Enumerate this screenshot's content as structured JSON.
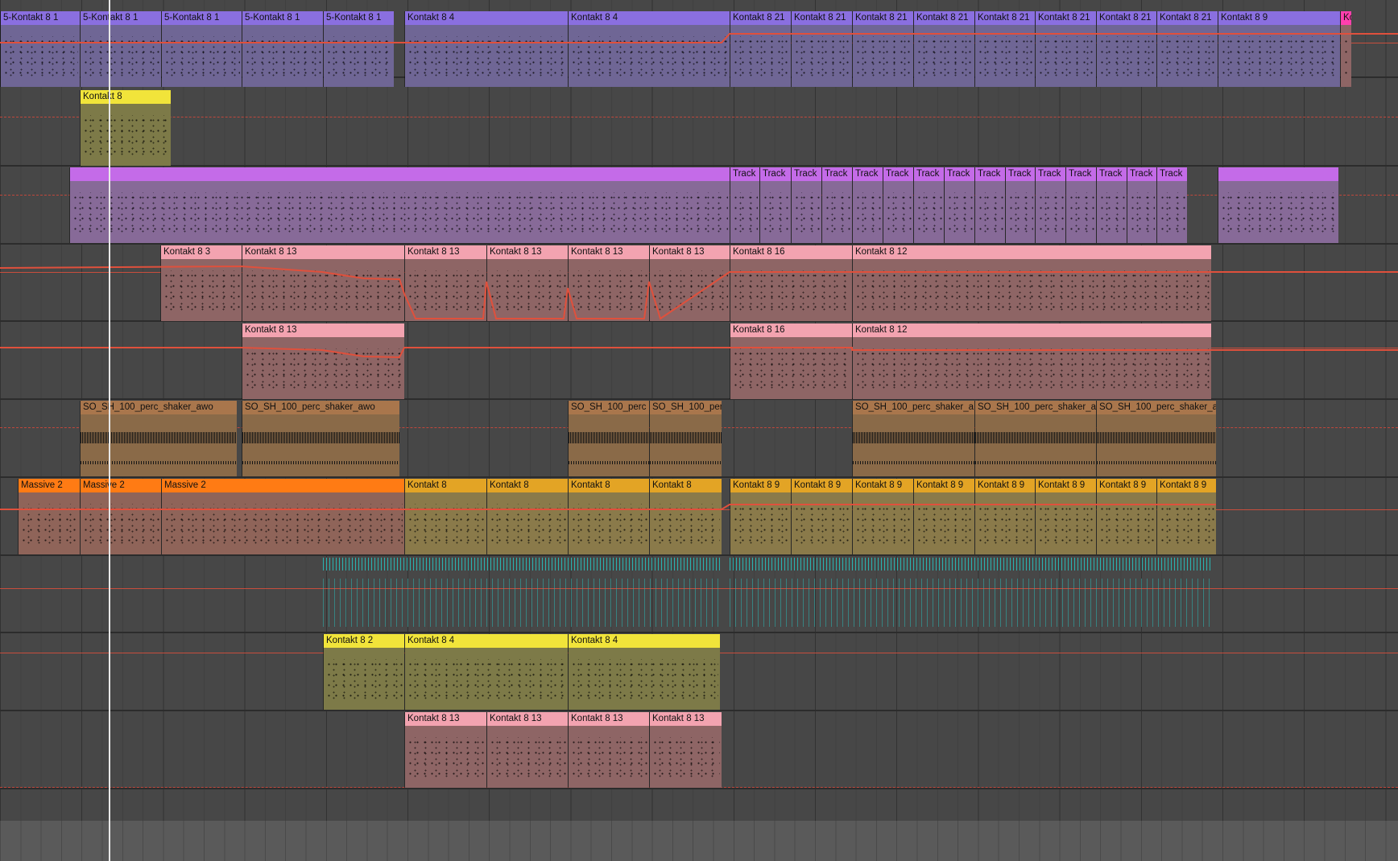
{
  "colors": {
    "violet_head": "#8a6fe0",
    "violet_body": "#6f6695",
    "yellow_head": "#f1e43a",
    "olive_body": "#7d7a48",
    "purple_head": "#c46be8",
    "purple_body": "#876a98",
    "pink_head": "#f3a3b0",
    "pink_body": "#8e6565",
    "brown_head": "#a9764c",
    "brown_body": "#8a6a48",
    "orange_head": "#ff7b14",
    "orange_body": "#8f6459",
    "gold_head": "#e3a425",
    "gold_body": "#8a7a4a",
    "magenta_head": "#ff3fae",
    "automation": "#e0503c",
    "playhead": "#e8e8e8"
  },
  "tracks": [
    {
      "name": "track-1",
      "clips": [
        {
          "label": "5-Kontakt 8 1",
          "color": "violet"
        },
        {
          "label": "5-Kontakt 8 1",
          "color": "violet"
        },
        {
          "label": "5-Kontakt 8 1",
          "color": "violet"
        },
        {
          "label": "5-Kontakt 8 1",
          "color": "violet"
        },
        {
          "label": "5-Kontakt 8 1",
          "color": "violet"
        },
        {
          "label": "Kontakt 8 4",
          "color": "violet"
        },
        {
          "label": "Kontakt 8 4",
          "color": "violet"
        },
        {
          "label": "Kontakt 8 21",
          "color": "violet"
        },
        {
          "label": "Kontakt 8 21",
          "color": "violet"
        },
        {
          "label": "Kontakt 8 21",
          "color": "violet"
        },
        {
          "label": "Kontakt 8 21",
          "color": "violet"
        },
        {
          "label": "Kontakt 8 21",
          "color": "violet"
        },
        {
          "label": "Kontakt 8 21",
          "color": "violet"
        },
        {
          "label": "Kontakt 8 21",
          "color": "violet"
        },
        {
          "label": "Kontakt 8 21",
          "color": "violet"
        },
        {
          "label": "Kontakt 8 9",
          "color": "violet"
        },
        {
          "label": "Ko",
          "color": "magenta"
        }
      ]
    },
    {
      "name": "track-2",
      "clips": [
        {
          "label": "Kontakt 8",
          "color": "yellow"
        }
      ]
    },
    {
      "name": "track-3",
      "clips": [
        {
          "label": "",
          "color": "purple"
        },
        {
          "label": "Track",
          "color": "purple"
        },
        {
          "label": "Track",
          "color": "purple"
        },
        {
          "label": "Track",
          "color": "purple"
        },
        {
          "label": "Track",
          "color": "purple"
        },
        {
          "label": "Track",
          "color": "purple"
        },
        {
          "label": "Track",
          "color": "purple"
        },
        {
          "label": "Track",
          "color": "purple"
        },
        {
          "label": "Track",
          "color": "purple"
        },
        {
          "label": "Track",
          "color": "purple"
        },
        {
          "label": "Track",
          "color": "purple"
        },
        {
          "label": "Track",
          "color": "purple"
        },
        {
          "label": "Track",
          "color": "purple"
        },
        {
          "label": "Track",
          "color": "purple"
        },
        {
          "label": "Track",
          "color": "purple"
        },
        {
          "label": "Track",
          "color": "purple"
        },
        {
          "label": "",
          "color": "purple"
        }
      ]
    },
    {
      "name": "track-4",
      "clips": [
        {
          "label": "Kontakt 8 3",
          "color": "pink"
        },
        {
          "label": "Kontakt 8 13",
          "color": "pink"
        },
        {
          "label": "Kontakt 8 13",
          "color": "pink"
        },
        {
          "label": "Kontakt 8 13",
          "color": "pink"
        },
        {
          "label": "Kontakt 8 13",
          "color": "pink"
        },
        {
          "label": "Kontakt 8 13",
          "color": "pink"
        },
        {
          "label": "Kontakt 8 16",
          "color": "pink"
        },
        {
          "label": "Kontakt 8 12",
          "color": "pink"
        }
      ]
    },
    {
      "name": "track-5",
      "clips": [
        {
          "label": "Kontakt 8 13",
          "color": "pink"
        },
        {
          "label": "Kontakt 8 16",
          "color": "pink"
        },
        {
          "label": "Kontakt 8 12",
          "color": "pink"
        }
      ]
    },
    {
      "name": "track-6",
      "clips": [
        {
          "label": "SO_SH_100_perc_shaker_awo",
          "color": "brown"
        },
        {
          "label": "SO_SH_100_perc_shaker_awo",
          "color": "brown"
        },
        {
          "label": "SO_SH_100_perc",
          "color": "brown"
        },
        {
          "label": "SO_SH_100_perc",
          "color": "brown"
        },
        {
          "label": "SO_SH_100_perc_shaker_a",
          "color": "brown"
        },
        {
          "label": "SO_SH_100_perc_shaker_a",
          "color": "brown"
        },
        {
          "label": "SO_SH_100_perc_shaker_a",
          "color": "brown"
        }
      ]
    },
    {
      "name": "track-7",
      "clips": [
        {
          "label": "Massive 2",
          "color": "orange"
        },
        {
          "label": "Massive 2",
          "color": "orange"
        },
        {
          "label": "Massive 2",
          "color": "orange"
        },
        {
          "label": "Kontakt 8",
          "color": "gold"
        },
        {
          "label": "Kontakt 8",
          "color": "gold"
        },
        {
          "label": "Kontakt 8",
          "color": "gold"
        },
        {
          "label": "Kontakt 8",
          "color": "gold"
        },
        {
          "label": "Kontakt 8 9",
          "color": "gold"
        },
        {
          "label": "Kontakt 8 9",
          "color": "gold"
        },
        {
          "label": "Kontakt 8 9",
          "color": "gold"
        },
        {
          "label": "Kontakt 8 9",
          "color": "gold"
        },
        {
          "label": "Kontakt 8 9",
          "color": "gold"
        },
        {
          "label": "Kontakt 8 9",
          "color": "gold"
        },
        {
          "label": "Kontakt 8 9",
          "color": "gold"
        },
        {
          "label": "Kontakt 8 9",
          "color": "gold"
        }
      ]
    },
    {
      "name": "track-8",
      "clips": []
    },
    {
      "name": "track-9",
      "clips": [
        {
          "label": "Kontakt 8 2",
          "color": "yellow"
        },
        {
          "label": "Kontakt 8 4",
          "color": "yellow"
        },
        {
          "label": "Kontakt 8 4",
          "color": "yellow"
        }
      ]
    },
    {
      "name": "track-10",
      "clips": [
        {
          "label": "Kontakt 8 13",
          "color": "pink"
        },
        {
          "label": "Kontakt 8 13",
          "color": "pink"
        },
        {
          "label": "Kontakt 8 13",
          "color": "pink"
        },
        {
          "label": "Kontakt 8 13",
          "color": "pink"
        }
      ]
    }
  ]
}
